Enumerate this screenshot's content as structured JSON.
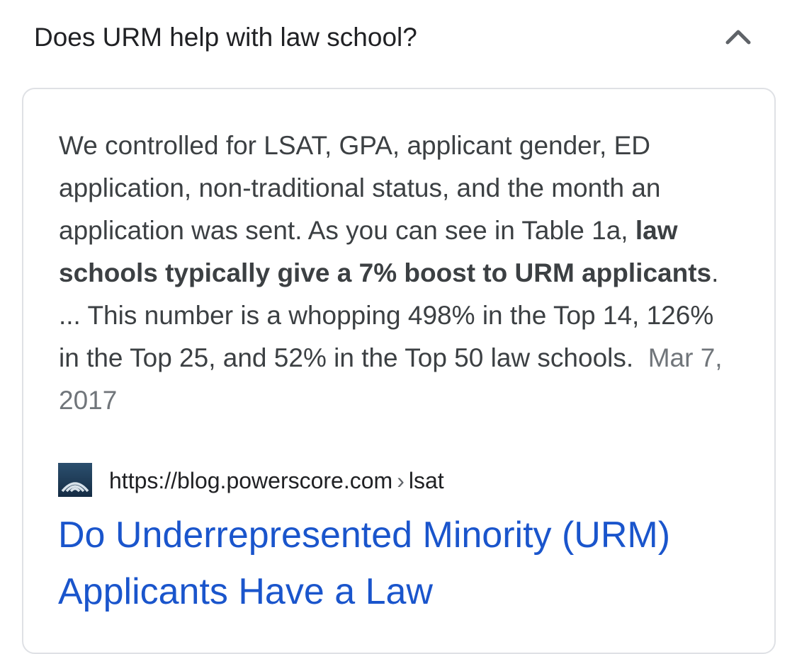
{
  "question": {
    "text": "Does URM help with law school?",
    "toggle_icon": "chevron-up-icon"
  },
  "snippet": {
    "before_bold": "We controlled for LSAT, GPA, applicant gender, ED application, non-traditional status, and the month an application was sent. As you can see in Table 1a, ",
    "bold": "law schools typically give a 7% boost to URM applicants",
    "after_bold": ". ... This number is a whopping 498% in the Top 14, 126% in the Top 25, and 52% in the Top 50 law schools.",
    "date": "Mar 7, 2017"
  },
  "source": {
    "favicon": "powerscore-favicon-icon",
    "domain": "https://blog.powerscore.com",
    "separator": "›",
    "path": "lsat"
  },
  "result": {
    "title": "Do Underrepresented Minority (URM) Applicants Have a Law"
  },
  "colors": {
    "link": "#1a55cc",
    "text": "#3c4043",
    "date": "#70757a",
    "border": "#dfe1e5"
  }
}
